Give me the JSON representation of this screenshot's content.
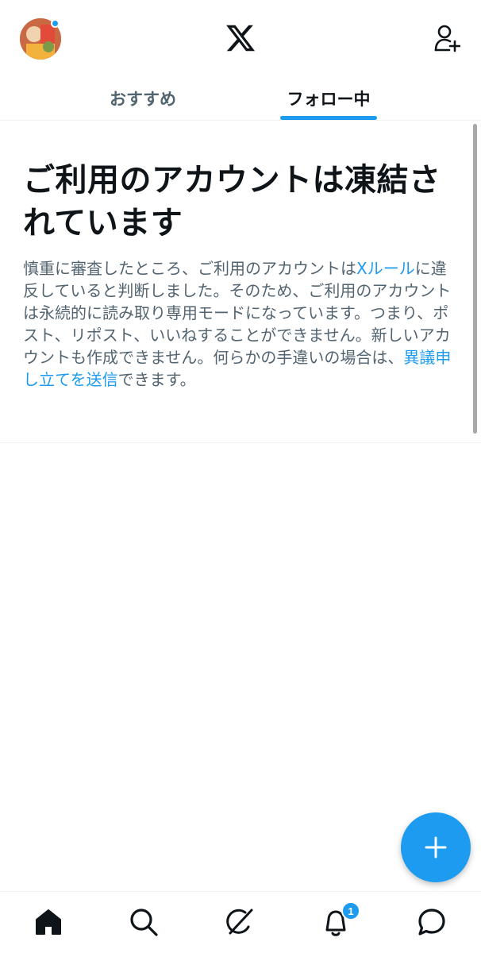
{
  "header": {
    "tabs": [
      {
        "label": "おすすめ",
        "active": false
      },
      {
        "label": "フォロー中",
        "active": true
      }
    ]
  },
  "notice": {
    "title": "ご利用のアカウントは凍結されています",
    "body_part1": "慎重に審査したところ、ご利用のアカウントは",
    "rules_link": "Xルール",
    "body_part2": "に違反していると判断しました。そのため、ご利用のアカウントは永続的に読み取り専用モードになっています。つまり、ポスト、リポスト、いいねすることができません。新しいアカウントも作成できません。何らかの手違いの場合は、",
    "appeal_link": "異議申し立てを送信",
    "body_part3": "できます。"
  },
  "bottom_nav": {
    "items": [
      "home-icon",
      "search-icon",
      "grok-icon",
      "bell-icon",
      "messages-icon"
    ],
    "notification_count": "1"
  },
  "colors": {
    "accent": "#1d9bf0",
    "text_primary": "#0f1419",
    "text_secondary": "#536471"
  }
}
